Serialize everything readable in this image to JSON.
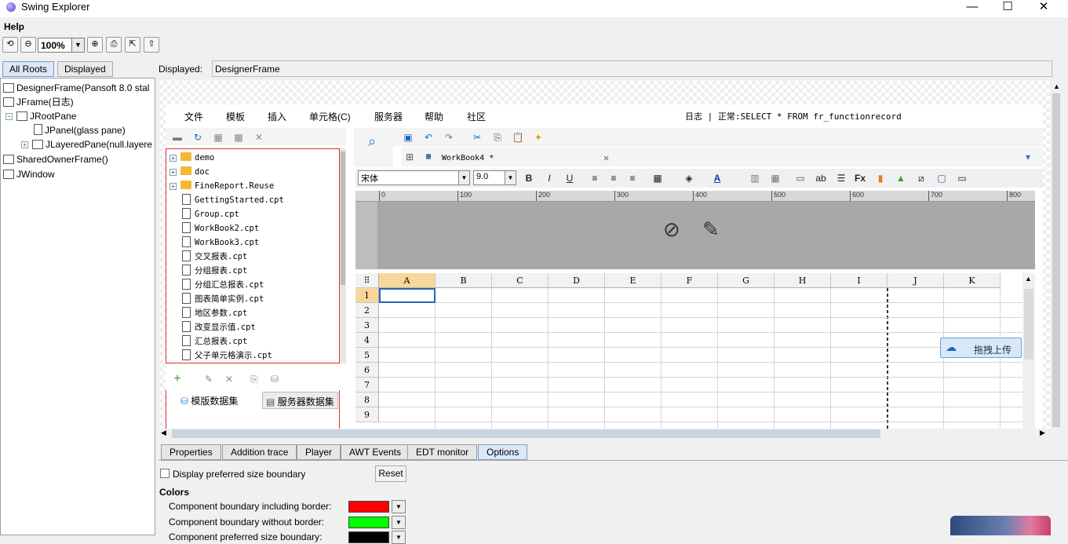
{
  "window": {
    "title": "Swing Explorer",
    "controls": [
      "—",
      "☐",
      "✕"
    ]
  },
  "menu": {
    "help": "Help"
  },
  "toolbar": {
    "zoom": "100%"
  },
  "left_tabs": [
    "All Roots",
    "Displayed"
  ],
  "tree": [
    {
      "label": "DesignerFrame(Pansoft 8.0 stal",
      "level": 0
    },
    {
      "label": "JFrame(日志)",
      "level": 0
    },
    {
      "label": "JRootPane",
      "level": 1,
      "expander": "−"
    },
    {
      "label": "JPanel(glass pane)",
      "level": 2
    },
    {
      "label": "JLayeredPane(null.layere",
      "level": 2,
      "expander": "+"
    },
    {
      "label": "SharedOwnerFrame()",
      "level": 0
    },
    {
      "label": "JWindow",
      "level": 0
    }
  ],
  "displayed": {
    "label": "Displayed:",
    "value": "DesignerFrame"
  },
  "designer": {
    "menus": [
      "文件",
      "模板",
      "插入",
      "单元格(C)",
      "服务器",
      "帮助",
      "社区"
    ],
    "status": "日志 | 正常:SELECT * FROM fr_functionrecord",
    "files": [
      {
        "name": "demo",
        "type": "folder"
      },
      {
        "name": "doc",
        "type": "folder"
      },
      {
        "name": "FineReport.Reuse",
        "type": "folder"
      },
      {
        "name": "GettingStarted.cpt",
        "type": "file"
      },
      {
        "name": "Group.cpt",
        "type": "file"
      },
      {
        "name": "WorkBook2.cpt",
        "type": "file"
      },
      {
        "name": "WorkBook3.cpt",
        "type": "file"
      },
      {
        "name": "交叉报表.cpt",
        "type": "file"
      },
      {
        "name": "分组报表.cpt",
        "type": "file"
      },
      {
        "name": "分组汇总报表.cpt",
        "type": "file"
      },
      {
        "name": "图表简单实例.cpt",
        "type": "file"
      },
      {
        "name": "地区参数.cpt",
        "type": "file"
      },
      {
        "name": "改变显示值.cpt",
        "type": "file"
      },
      {
        "name": "汇总报表.cpt",
        "type": "file"
      },
      {
        "name": "父子单元格演示.cpt",
        "type": "file"
      }
    ],
    "dataset_tabs": [
      "模版数据集",
      "服务器数据集"
    ],
    "workbook_tab": "WorkBook4 *",
    "font_name": "宋体",
    "font_size": "9.0",
    "ruler_ticks": [
      "0",
      "100",
      "200",
      "300",
      "400",
      "500",
      "600",
      "700",
      "800"
    ],
    "columns": [
      "A",
      "B",
      "C",
      "D",
      "E",
      "F",
      "G",
      "H",
      "I",
      "J",
      "K"
    ],
    "rows": [
      "1",
      "2",
      "3",
      "4",
      "5",
      "6",
      "7",
      "8",
      "9"
    ],
    "upload_label": "拖拽上传"
  },
  "bottom_tabs": [
    "Properties",
    "Addition trace",
    "Player",
    "AWT Events",
    "EDT monitor",
    "Options"
  ],
  "options": {
    "checkbox_label": "Display preferred size boundary",
    "reset": "Reset",
    "colors_heading": "Colors",
    "color_rows": [
      {
        "label": "Component boundary including border:",
        "color": "#ff0000"
      },
      {
        "label": "Component boundary without border:",
        "color": "#00ff00"
      },
      {
        "label": "Component preferred size boundary:",
        "color": "#000000"
      }
    ]
  }
}
